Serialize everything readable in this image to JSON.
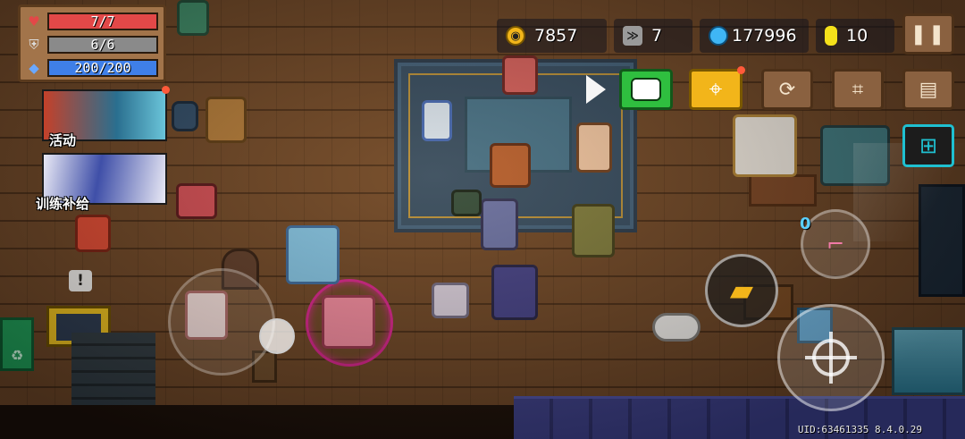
{
  "stats": {
    "hp": {
      "icon": "heart-icon",
      "text": "7/7",
      "fraction": 1.0,
      "color": "#e24848"
    },
    "armor": {
      "icon": "shield-icon",
      "text": "6/6",
      "fraction": 1.0,
      "color": "#8a8a8a"
    },
    "energy": {
      "icon": "diamond-icon",
      "text": "200/200",
      "fraction": 1.0,
      "color": "#3f7fe8"
    }
  },
  "events": [
    {
      "label": "活动",
      "has_notification": true
    },
    {
      "label": "训练补给",
      "has_notification": false
    }
  ],
  "currencies": {
    "gold": {
      "icon": "coin-icon",
      "value": "7857",
      "color": "#f2b51a"
    },
    "fish": {
      "icon": "fish-icon",
      "value": "7",
      "color": "#c8c8c8"
    },
    "gems": {
      "icon": "gem-icon",
      "value": "177996",
      "color": "#3fb6f5"
    },
    "materials": {
      "icon": "material-icon",
      "value": "10",
      "color": "#f5e11a"
    }
  },
  "buttons": {
    "pause": {
      "icon": "pause-icon"
    },
    "chat": {
      "icon": "chat-icon"
    },
    "map": {
      "icon": "location-pin-icon",
      "has_notification": true
    },
    "refresh": {
      "icon": "refresh-icon"
    },
    "stairs": {
      "icon": "stairs-icon"
    },
    "profile": {
      "icon": "id-card-icon"
    },
    "shop": {
      "icon": "shopping-cart-icon"
    }
  },
  "controls": {
    "skill_count": "0",
    "weapon": "golden-gun-icon"
  },
  "notice": "!",
  "uid": "UID:63461335 8.4.0.29"
}
